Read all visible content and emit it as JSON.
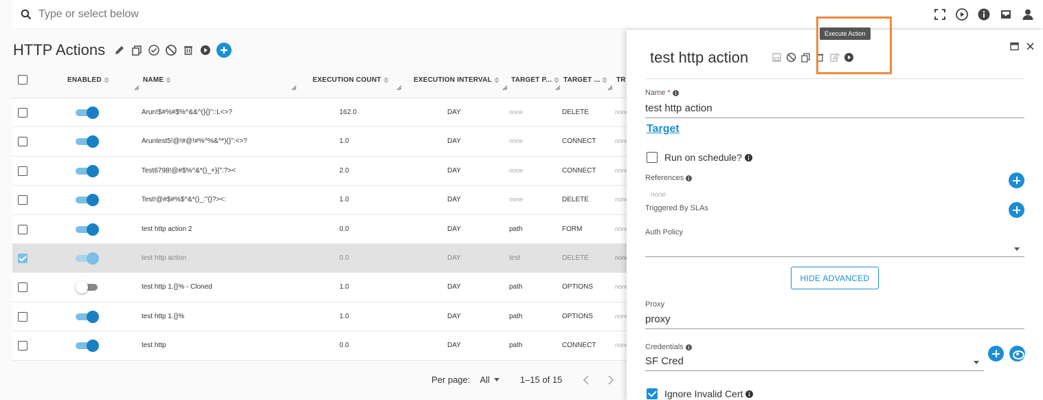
{
  "search": {
    "placeholder": "Type or select below"
  },
  "page": {
    "title": "HTTP Actions"
  },
  "table": {
    "columns": [
      "ENABLED",
      "NAME",
      "EXECUTION COUNT",
      "EXECUTION INTERVAL",
      "TARGET P...",
      "TARGET ...",
      "TR"
    ],
    "rows": [
      {
        "name": "Arun!$#%#$%^&&^(}{}\"::L<>?",
        "count": "162.0",
        "interval": "DAY",
        "target_path": "none",
        "target_method": "DELETE",
        "tr": "none",
        "enabled": true,
        "selected": false
      },
      {
        "name": "Aruntest5!@!#@!#%^%&^*)(}\":<>?",
        "count": "1.0",
        "interval": "DAY",
        "target_path": "none",
        "target_method": "CONNECT",
        "tr": "none",
        "enabled": true,
        "selected": false
      },
      {
        "name": "Test6798!@#$%^&*()_+}{\":?><",
        "count": "2.0",
        "interval": "DAY",
        "target_path": "none",
        "target_method": "CONNECT",
        "tr": "none",
        "enabled": true,
        "selected": false
      },
      {
        "name": "Test!@#$#%$^&*()_:\"{}?><:",
        "count": "1.0",
        "interval": "DAY",
        "target_path": "none",
        "target_method": "DELETE",
        "tr": "none",
        "enabled": true,
        "selected": false
      },
      {
        "name": "test http action 2",
        "count": "0.0",
        "interval": "DAY",
        "target_path": "path",
        "target_method": "FORM",
        "tr": "none",
        "enabled": true,
        "selected": false
      },
      {
        "name": "test http action",
        "count": "0.0",
        "interval": "DAY",
        "target_path": "test",
        "target_method": "DELETE",
        "tr": "none",
        "enabled": true,
        "selected": true
      },
      {
        "name": "test http 1.{}% - Cloned",
        "count": "1.0",
        "interval": "DAY",
        "target_path": "path",
        "target_method": "OPTIONS",
        "tr": "none",
        "enabled": false,
        "selected": false
      },
      {
        "name": "test http 1.{}%",
        "count": "1.0",
        "interval": "DAY",
        "target_path": "path",
        "target_method": "OPTIONS",
        "tr": "none",
        "enabled": true,
        "selected": false
      },
      {
        "name": "test http",
        "count": "0.0",
        "interval": "DAY",
        "target_path": "path",
        "target_method": "CONNECT",
        "tr": "none",
        "enabled": true,
        "selected": false
      }
    ]
  },
  "pagination": {
    "per_page_label": "Per page:",
    "per_page_value": "All",
    "range": "1–15 of 15"
  },
  "panel": {
    "title": "test http action",
    "tooltip": "Execute Action",
    "name_label": "Name",
    "name_required": "*",
    "name_value": "test http action",
    "target_link": "Target",
    "run_on_schedule_label": "Run on schedule?",
    "references_label": "References",
    "references_value": "none",
    "triggered_by_label": "Triggered By SLAs",
    "auth_policy_label": "Auth Policy",
    "hide_advanced_label": "HIDE ADVANCED",
    "proxy_label": "Proxy",
    "proxy_value": "proxy",
    "credentials_label": "Credentials",
    "credentials_value": "SF Cred",
    "ignore_invalid_cert_label": "Ignore Invalid Cert"
  },
  "colors": {
    "accent": "#1a8fd6",
    "highlight": "#f0893a",
    "selected_row": "#e2e2e2"
  }
}
